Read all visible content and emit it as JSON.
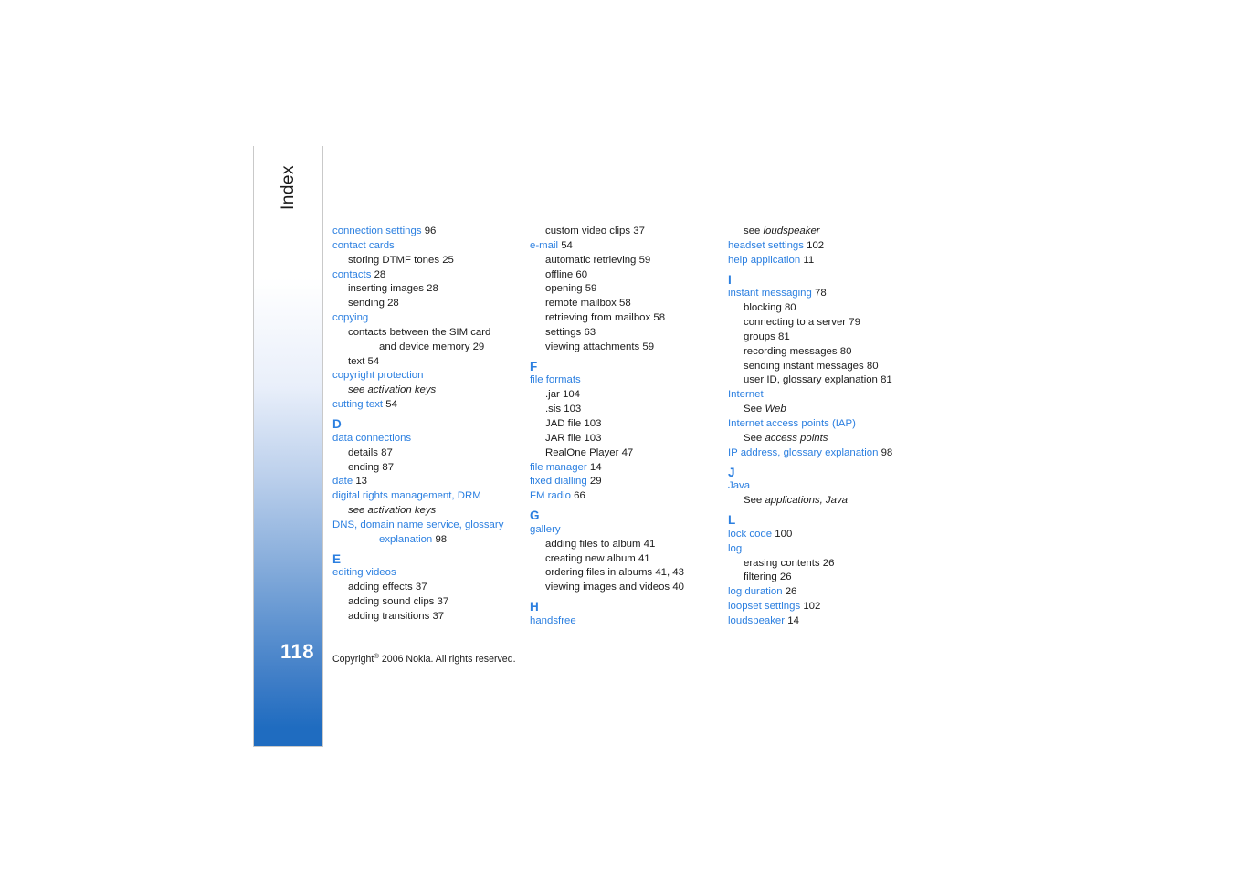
{
  "page": {
    "number": "118",
    "section_label": "Index",
    "copyright_prefix": "Copyright",
    "copyright_symbol": "®",
    "copyright_suffix": "2006 Nokia. All rights reserved.",
    "accent_color": "#2b7fe0",
    "tab_bottom_color": "#1f6cc0"
  },
  "columns": [
    {
      "id": "col-1",
      "entries": [
        {
          "kind": "entry",
          "level": 1,
          "style": "term",
          "text": "connection settings",
          "page": "96"
        },
        {
          "kind": "entry",
          "level": 1,
          "style": "term",
          "text": "contact cards",
          "page": ""
        },
        {
          "kind": "entry",
          "level": 2,
          "style": "plain",
          "text": "storing DTMF tones",
          "page": "25"
        },
        {
          "kind": "entry",
          "level": 1,
          "style": "term",
          "text": "contacts",
          "page": "28"
        },
        {
          "kind": "entry",
          "level": 2,
          "style": "plain",
          "text": "inserting images",
          "page": "28"
        },
        {
          "kind": "entry",
          "level": 2,
          "style": "plain",
          "text": "sending",
          "page": "28"
        },
        {
          "kind": "entry",
          "level": 1,
          "style": "term",
          "text": "copying",
          "page": ""
        },
        {
          "kind": "entry",
          "level": 2,
          "style": "plain",
          "text": "contacts between the SIM card",
          "page": ""
        },
        {
          "kind": "entry",
          "level": 3,
          "style": "plain",
          "text": "and device memory",
          "page": "29"
        },
        {
          "kind": "entry",
          "level": 2,
          "style": "plain",
          "text": "text",
          "page": "54"
        },
        {
          "kind": "entry",
          "level": 1,
          "style": "term",
          "text": "copyright protection",
          "page": ""
        },
        {
          "kind": "entry",
          "level": 2,
          "style": "italic",
          "text": "see activation keys",
          "page": ""
        },
        {
          "kind": "entry",
          "level": 1,
          "style": "term",
          "text": "cutting text",
          "page": "54"
        },
        {
          "kind": "letter",
          "text": "D"
        },
        {
          "kind": "entry",
          "level": 1,
          "style": "term",
          "text": "data connections",
          "page": ""
        },
        {
          "kind": "entry",
          "level": 2,
          "style": "plain",
          "text": "details",
          "page": "87"
        },
        {
          "kind": "entry",
          "level": 2,
          "style": "plain",
          "text": "ending",
          "page": "87"
        },
        {
          "kind": "entry",
          "level": 1,
          "style": "term",
          "text": "date",
          "page": "13"
        },
        {
          "kind": "entry",
          "level": 1,
          "style": "term",
          "text": "digital rights management, DRM",
          "page": ""
        },
        {
          "kind": "entry",
          "level": 2,
          "style": "italic",
          "text": "see activation keys",
          "page": ""
        },
        {
          "kind": "entry",
          "level": 1,
          "style": "term",
          "text": "DNS, domain name service, glossary",
          "page": ""
        },
        {
          "kind": "entry",
          "level": 3,
          "style": "term",
          "text": "explanation",
          "page": "98"
        },
        {
          "kind": "letter",
          "text": "E"
        },
        {
          "kind": "entry",
          "level": 1,
          "style": "term",
          "text": "editing videos",
          "page": ""
        },
        {
          "kind": "entry",
          "level": 2,
          "style": "plain",
          "text": "adding effects",
          "page": "37"
        },
        {
          "kind": "entry",
          "level": 2,
          "style": "plain",
          "text": "adding sound clips",
          "page": "37"
        },
        {
          "kind": "entry",
          "level": 2,
          "style": "plain",
          "text": "adding transitions",
          "page": "37"
        }
      ]
    },
    {
      "id": "col-2",
      "entries": [
        {
          "kind": "entry",
          "level": 2,
          "style": "plain",
          "text": "custom video clips",
          "page": "37"
        },
        {
          "kind": "entry",
          "level": 1,
          "style": "term",
          "text": "e-mail",
          "page": "54"
        },
        {
          "kind": "entry",
          "level": 2,
          "style": "plain",
          "text": "automatic retrieving",
          "page": "59"
        },
        {
          "kind": "entry",
          "level": 2,
          "style": "plain",
          "text": "offline",
          "page": "60"
        },
        {
          "kind": "entry",
          "level": 2,
          "style": "plain",
          "text": "opening",
          "page": "59"
        },
        {
          "kind": "entry",
          "level": 2,
          "style": "plain",
          "text": "remote mailbox",
          "page": "58"
        },
        {
          "kind": "entry",
          "level": 2,
          "style": "plain",
          "text": "retrieving from mailbox",
          "page": "58"
        },
        {
          "kind": "entry",
          "level": 2,
          "style": "plain",
          "text": "settings",
          "page": "63"
        },
        {
          "kind": "entry",
          "level": 2,
          "style": "plain",
          "text": "viewing attachments",
          "page": "59"
        },
        {
          "kind": "letter",
          "text": "F"
        },
        {
          "kind": "entry",
          "level": 1,
          "style": "term",
          "text": "file formats",
          "page": ""
        },
        {
          "kind": "entry",
          "level": 2,
          "style": "plain",
          "text": ".jar",
          "page": "104"
        },
        {
          "kind": "entry",
          "level": 2,
          "style": "plain",
          "text": ".sis",
          "page": "103"
        },
        {
          "kind": "entry",
          "level": 2,
          "style": "plain",
          "text": "JAD file",
          "page": "103"
        },
        {
          "kind": "entry",
          "level": 2,
          "style": "plain",
          "text": "JAR file",
          "page": "103"
        },
        {
          "kind": "entry",
          "level": 2,
          "style": "plain",
          "text": "RealOne Player",
          "page": "47"
        },
        {
          "kind": "entry",
          "level": 1,
          "style": "term",
          "text": "file manager",
          "page": "14"
        },
        {
          "kind": "entry",
          "level": 1,
          "style": "term",
          "text": "fixed dialling",
          "page": "29"
        },
        {
          "kind": "entry",
          "level": 1,
          "style": "term",
          "text": "FM radio",
          "page": "66"
        },
        {
          "kind": "letter",
          "text": "G"
        },
        {
          "kind": "entry",
          "level": 1,
          "style": "term",
          "text": "gallery",
          "page": ""
        },
        {
          "kind": "entry",
          "level": 2,
          "style": "plain",
          "text": "adding files to album",
          "page": "41"
        },
        {
          "kind": "entry",
          "level": 2,
          "style": "plain",
          "text": "creating new album",
          "page": "41"
        },
        {
          "kind": "entry",
          "level": 2,
          "style": "plain",
          "text": "ordering files in albums",
          "page": "41, 43"
        },
        {
          "kind": "entry",
          "level": 2,
          "style": "plain",
          "text": "viewing images and videos",
          "page": "40"
        },
        {
          "kind": "letter",
          "text": "H"
        },
        {
          "kind": "entry",
          "level": 1,
          "style": "term",
          "text": "handsfree",
          "page": ""
        }
      ]
    },
    {
      "id": "col-3",
      "entries": [
        {
          "kind": "entry",
          "level": 2,
          "style": "see",
          "text": "see ",
          "italic_text": "loudspeaker",
          "page": ""
        },
        {
          "kind": "entry",
          "level": 1,
          "style": "term",
          "text": "headset settings",
          "page": "102"
        },
        {
          "kind": "entry",
          "level": 1,
          "style": "term",
          "text": "help application",
          "page": "11"
        },
        {
          "kind": "letter",
          "text": "I"
        },
        {
          "kind": "entry",
          "level": 1,
          "style": "term",
          "text": "instant messaging",
          "page": "78"
        },
        {
          "kind": "entry",
          "level": 2,
          "style": "plain",
          "text": "blocking",
          "page": "80"
        },
        {
          "kind": "entry",
          "level": 2,
          "style": "plain",
          "text": "connecting to a server",
          "page": "79"
        },
        {
          "kind": "entry",
          "level": 2,
          "style": "plain",
          "text": "groups",
          "page": "81"
        },
        {
          "kind": "entry",
          "level": 2,
          "style": "plain",
          "text": "recording messages",
          "page": "80"
        },
        {
          "kind": "entry",
          "level": 2,
          "style": "plain",
          "text": "sending instant messages",
          "page": "80"
        },
        {
          "kind": "entry",
          "level": 2,
          "style": "plain",
          "text": "user ID, glossary explanation",
          "page": "81"
        },
        {
          "kind": "entry",
          "level": 1,
          "style": "term",
          "text": "Internet",
          "page": ""
        },
        {
          "kind": "entry",
          "level": 2,
          "style": "see",
          "text": "See ",
          "italic_text": "Web",
          "page": ""
        },
        {
          "kind": "entry",
          "level": 1,
          "style": "term",
          "text": "Internet access points (IAP)",
          "page": ""
        },
        {
          "kind": "entry",
          "level": 2,
          "style": "see",
          "text": "See ",
          "italic_text": "access points",
          "page": ""
        },
        {
          "kind": "entry",
          "level": 1,
          "style": "term",
          "text": "IP address, glossary explanation",
          "page": "98"
        },
        {
          "kind": "letter",
          "text": "J"
        },
        {
          "kind": "entry",
          "level": 1,
          "style": "term",
          "text": "Java",
          "page": ""
        },
        {
          "kind": "entry",
          "level": 2,
          "style": "see",
          "text": "See ",
          "italic_text": "applications, Java",
          "page": ""
        },
        {
          "kind": "letter",
          "text": "L"
        },
        {
          "kind": "entry",
          "level": 1,
          "style": "term",
          "text": "lock code",
          "page": "100"
        },
        {
          "kind": "entry",
          "level": 1,
          "style": "term",
          "text": "log",
          "page": ""
        },
        {
          "kind": "entry",
          "level": 2,
          "style": "plain",
          "text": "erasing contents",
          "page": "26"
        },
        {
          "kind": "entry",
          "level": 2,
          "style": "plain",
          "text": "filtering",
          "page": "26"
        },
        {
          "kind": "entry",
          "level": 1,
          "style": "term",
          "text": "log duration",
          "page": "26"
        },
        {
          "kind": "entry",
          "level": 1,
          "style": "term",
          "text": "loopset settings",
          "page": "102"
        },
        {
          "kind": "entry",
          "level": 1,
          "style": "term",
          "text": "loudspeaker",
          "page": "14"
        }
      ]
    }
  ]
}
